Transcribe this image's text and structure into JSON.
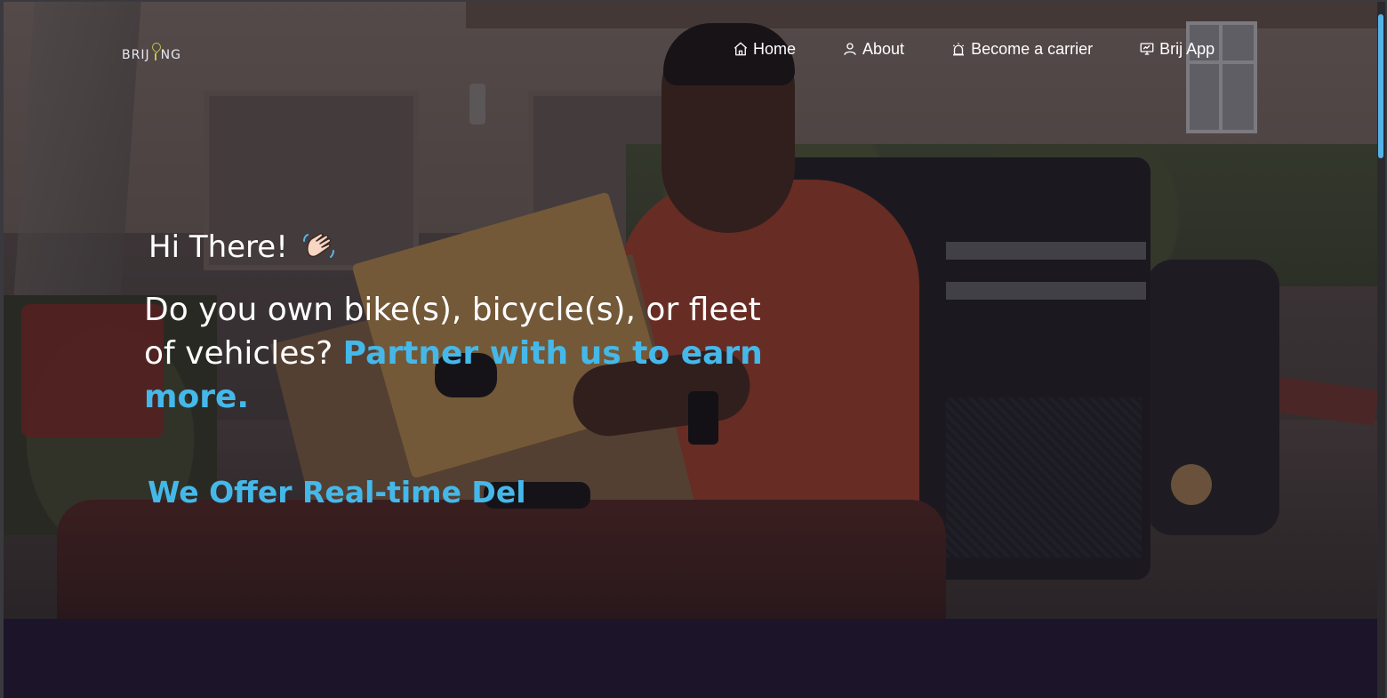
{
  "brand": {
    "logo_text_left": "BRIJ",
    "logo_text_right": "NG",
    "logo_pin_icon": "map-pin-icon"
  },
  "nav": {
    "items": [
      {
        "label": "Home",
        "icon": "home-icon"
      },
      {
        "label": "About",
        "icon": "user-icon"
      },
      {
        "label": "Become a carrier",
        "icon": "alarm-icon"
      },
      {
        "label": "Brij App",
        "icon": "monitor-icon"
      }
    ]
  },
  "hero": {
    "greeting": "Hi There!",
    "greeting_emoji": "waving-hand-icon",
    "headline_plain": "Do you own bike(s), bicycle(s), or fleet of vehicles? ",
    "headline_accent": "Partner with us to earn more.",
    "typed_text": "We Offer Real-time Del"
  },
  "colors": {
    "accent": "#45b8ea",
    "overlay": "rgba(24,18,30,0.48)",
    "footer_bg": "#1c1429",
    "scroll_thumb": "#56b3e8"
  }
}
